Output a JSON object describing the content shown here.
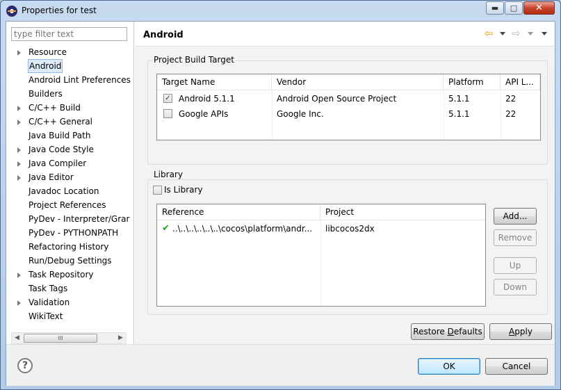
{
  "window": {
    "title": "Properties for test",
    "min_glyph": "▬",
    "max_glyph": "□",
    "close_glyph": "✕"
  },
  "sidebar": {
    "filter_placeholder": "type filter text",
    "items": [
      {
        "label": "Resource",
        "expandable": true
      },
      {
        "label": "Android",
        "expandable": false,
        "selected": true
      },
      {
        "label": "Android Lint Preferences",
        "expandable": false
      },
      {
        "label": "Builders",
        "expandable": false
      },
      {
        "label": "C/C++ Build",
        "expandable": true
      },
      {
        "label": "C/C++ General",
        "expandable": true
      },
      {
        "label": "Java Build Path",
        "expandable": false
      },
      {
        "label": "Java Code Style",
        "expandable": true
      },
      {
        "label": "Java Compiler",
        "expandable": true
      },
      {
        "label": "Java Editor",
        "expandable": true
      },
      {
        "label": "Javadoc Location",
        "expandable": false
      },
      {
        "label": "Project References",
        "expandable": false
      },
      {
        "label": "PyDev - Interpreter/Grar",
        "expandable": false
      },
      {
        "label": "PyDev - PYTHONPATH",
        "expandable": false
      },
      {
        "label": "Refactoring History",
        "expandable": false
      },
      {
        "label": "Run/Debug Settings",
        "expandable": false
      },
      {
        "label": "Task Repository",
        "expandable": true
      },
      {
        "label": "Task Tags",
        "expandable": false
      },
      {
        "label": "Validation",
        "expandable": true
      },
      {
        "label": "WikiText",
        "expandable": false
      }
    ],
    "scroll_left": "◀",
    "scroll_right": "▶",
    "scroll_thumb": "III"
  },
  "page": {
    "title": "Android",
    "back_glyph": "⇦",
    "forward_glyph": "⇨",
    "build_target": {
      "group_title": "Project Build Target",
      "columns": [
        "Target Name",
        "Vendor",
        "Platform",
        "API L..."
      ],
      "rows": [
        {
          "checked": true,
          "name": "Android 5.1.1",
          "vendor": "Android Open Source Project",
          "platform": "5.1.1",
          "api": "22"
        },
        {
          "checked": false,
          "name": "Google APIs",
          "vendor": "Google Inc.",
          "platform": "5.1.1",
          "api": "22"
        }
      ]
    },
    "library": {
      "group_title": "Library",
      "is_library_label": "Is Library",
      "is_library_checked": false,
      "columns": [
        "Reference",
        "Project"
      ],
      "rows": [
        {
          "reference": "..\\..\\..\\..\\..\\..\\cocos\\platform\\andr...",
          "project": "libcocos2dx"
        }
      ],
      "buttons": {
        "add": "Add...",
        "remove": "Remove",
        "up": "Up",
        "down": "Down"
      }
    },
    "restore_defaults_pre": "Restore ",
    "restore_defaults_key": "D",
    "restore_defaults_post": "efaults",
    "apply_key": "A",
    "apply_rest": "pply"
  },
  "footer": {
    "help": "?",
    "ok": "OK",
    "cancel": "Cancel"
  },
  "check_glyph": "✓",
  "ref_ok_glyph": "✔"
}
